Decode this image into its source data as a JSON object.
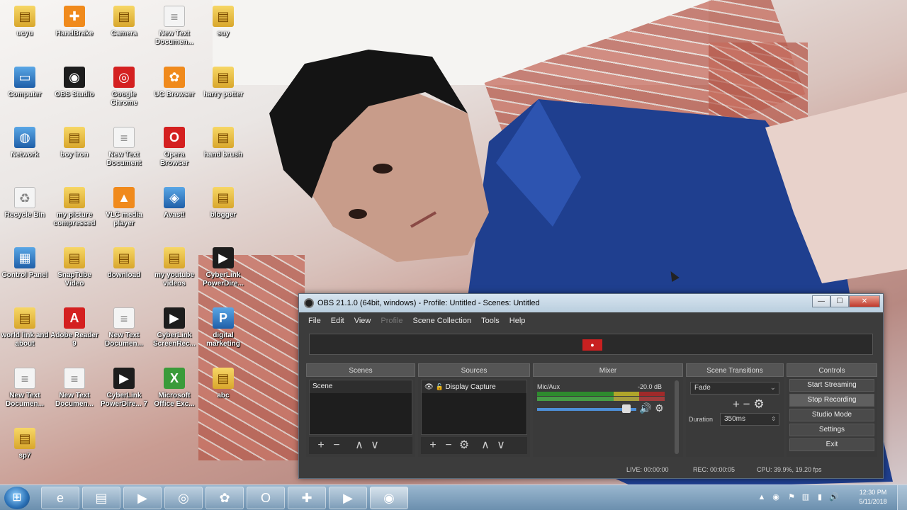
{
  "desktop_icons": [
    {
      "label": "ucyu",
      "icon": "folder-icon",
      "glyph": "▤",
      "style": "g-folder"
    },
    {
      "label": "HandBrake",
      "icon": "handbrake-icon",
      "glyph": "✚",
      "style": "g-orange"
    },
    {
      "label": "Camera",
      "icon": "folder-icon",
      "glyph": "▤",
      "style": "g-folder"
    },
    {
      "label": "New Text Documen...",
      "icon": "text-document-icon",
      "glyph": "≡",
      "style": "g-doc"
    },
    {
      "label": "suy",
      "icon": "folder-icon",
      "glyph": "▤",
      "style": "g-folder"
    },
    {
      "label": "Computer",
      "icon": "computer-icon",
      "glyph": "▭",
      "style": "g-blue"
    },
    {
      "label": "OBS Studio",
      "icon": "obs-studio-icon",
      "glyph": "◉",
      "style": "g-app"
    },
    {
      "label": "Google Chrome",
      "icon": "chrome-icon",
      "glyph": "◎",
      "style": "g-red"
    },
    {
      "label": "UC Browser",
      "icon": "uc-browser-icon",
      "glyph": "✿",
      "style": "g-orange"
    },
    {
      "label": "harry potter",
      "icon": "folder-icon",
      "glyph": "▤",
      "style": "g-folder"
    },
    {
      "label": "Network",
      "icon": "network-icon",
      "glyph": "◍",
      "style": "g-blue"
    },
    {
      "label": "boy iron",
      "icon": "folder-icon",
      "glyph": "▤",
      "style": "g-folder"
    },
    {
      "label": "New Text Document",
      "icon": "text-document-icon",
      "glyph": "≡",
      "style": "g-doc"
    },
    {
      "label": "Opera Browser",
      "icon": "opera-icon",
      "glyph": "O",
      "style": "g-red"
    },
    {
      "label": "hand brush",
      "icon": "folder-icon",
      "glyph": "▤",
      "style": "g-folder"
    },
    {
      "label": "Recycle Bin",
      "icon": "recycle-bin-icon",
      "glyph": "♻",
      "style": "g-doc"
    },
    {
      "label": "my picture compressed",
      "icon": "folder-icon",
      "glyph": "▤",
      "style": "g-folder"
    },
    {
      "label": "VLC media player",
      "icon": "vlc-icon",
      "glyph": "▲",
      "style": "g-orange"
    },
    {
      "label": "Avast!",
      "icon": "avast-icon",
      "glyph": "◈",
      "style": "g-blue"
    },
    {
      "label": "blogger",
      "icon": "folder-icon",
      "glyph": "▤",
      "style": "g-folder"
    },
    {
      "label": "Control Panel",
      "icon": "control-panel-icon",
      "glyph": "▦",
      "style": "g-blue"
    },
    {
      "label": "SnapTube Video",
      "icon": "folder-icon",
      "glyph": "▤",
      "style": "g-folder"
    },
    {
      "label": "download",
      "icon": "folder-icon",
      "glyph": "▤",
      "style": "g-folder"
    },
    {
      "label": "my youtube videos",
      "icon": "folder-icon",
      "glyph": "▤",
      "style": "g-folder"
    },
    {
      "label": "CyberLink PowerDire...",
      "icon": "cyberlink-powerdirector-icon",
      "glyph": "▶",
      "style": "g-app"
    },
    {
      "label": "world link and about",
      "icon": "folder-icon",
      "glyph": "▤",
      "style": "g-folder"
    },
    {
      "label": "Adobe Reader 9",
      "icon": "adobe-reader-icon",
      "glyph": "A",
      "style": "g-red"
    },
    {
      "label": "New Text Documen...",
      "icon": "text-document-icon",
      "glyph": "≡",
      "style": "g-doc"
    },
    {
      "label": "CyberLink ScreenRec...",
      "icon": "cyberlink-screen-recorder-icon",
      "glyph": "▶",
      "style": "g-app"
    },
    {
      "label": "digital marketing",
      "icon": "publisher-icon",
      "glyph": "P",
      "style": "g-blue"
    },
    {
      "label": "New Text Documen...",
      "icon": "text-document-icon",
      "glyph": "≡",
      "style": "g-doc"
    },
    {
      "label": "New Text Documen...",
      "icon": "text-document-icon",
      "glyph": "≡",
      "style": "g-doc"
    },
    {
      "label": "CyberLink PowerDire... 7",
      "icon": "cyberlink-powerdirector-icon",
      "glyph": "▶",
      "style": "g-app"
    },
    {
      "label": "Microsoft Office Exc...",
      "icon": "excel-icon",
      "glyph": "X",
      "style": "g-green"
    },
    {
      "label": "abc",
      "icon": "folder-icon",
      "glyph": "▤",
      "style": "g-folder"
    },
    {
      "label": "sp7",
      "icon": "folder-icon",
      "glyph": "▤",
      "style": "g-folder"
    }
  ],
  "obs": {
    "title": "OBS 21.1.0 (64bit, windows) - Profile: Untitled - Scenes: Untitled",
    "window_buttons": {
      "minimize": "—",
      "maximize": "☐",
      "close": "✕"
    },
    "menu": [
      "File",
      "Edit",
      "View",
      "Profile",
      "Scene Collection",
      "Tools",
      "Help"
    ],
    "disabled_menu": "Profile",
    "docks": {
      "scenes": {
        "title": "Scenes",
        "items": [
          "Scene"
        ]
      },
      "sources": {
        "title": "Sources",
        "items": [
          "Display Capture"
        ]
      },
      "mixer": {
        "title": "Mixer",
        "channel": "Mic/Aux",
        "db": "-20.0 dB",
        "volume_fraction": 0.9
      },
      "transitions": {
        "title": "Scene Transitions",
        "transition": "Fade",
        "duration_label": "Duration",
        "duration": "350ms"
      },
      "controls": {
        "title": "Controls",
        "buttons": [
          "Start Streaming",
          "Stop Recording",
          "Studio Mode",
          "Settings",
          "Exit"
        ],
        "active_button": "Stop Recording"
      }
    },
    "toolbar_glyphs": {
      "add": "+",
      "remove": "−",
      "up": "∧",
      "down": "∨",
      "gear": "⚙"
    },
    "status": {
      "live": "LIVE: 00:00:00",
      "rec": "REC: 00:00:05",
      "cpu": "CPU: 39.9%, 19.20 fps"
    }
  },
  "taskbar": {
    "apps": [
      {
        "name": "internet-explorer",
        "glyph": "e"
      },
      {
        "name": "windows-explorer",
        "glyph": "▤"
      },
      {
        "name": "media-player",
        "glyph": "▶"
      },
      {
        "name": "chrome",
        "glyph": "◎"
      },
      {
        "name": "uc-browser",
        "glyph": "✿"
      },
      {
        "name": "opera",
        "glyph": "O"
      },
      {
        "name": "handbrake",
        "glyph": "✚"
      },
      {
        "name": "cyberlink-screen-recorder",
        "glyph": "▶"
      },
      {
        "name": "obs-studio",
        "glyph": "◉"
      }
    ],
    "active_app": "obs-studio",
    "time": "12:30 PM",
    "date": "5/11/2018"
  }
}
